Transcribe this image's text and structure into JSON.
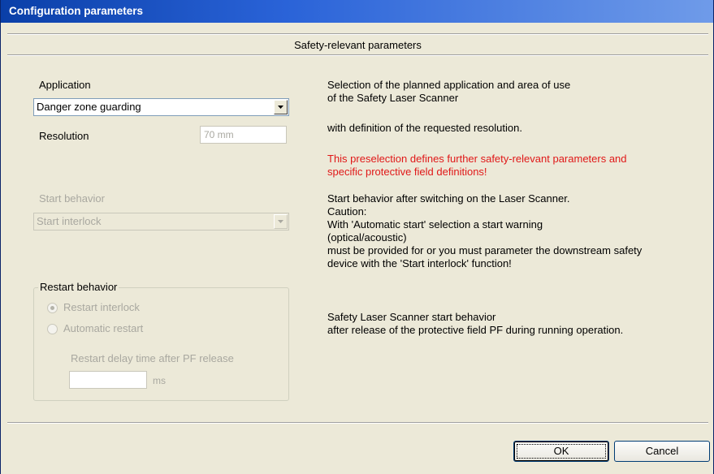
{
  "window": {
    "title": "Configuration parameters"
  },
  "section": {
    "title": "Safety-relevant parameters"
  },
  "application": {
    "label": "Application",
    "selected": "Danger zone guarding"
  },
  "resolution": {
    "label": "Resolution",
    "value": "70 mm"
  },
  "start_behavior": {
    "label": "Start behavior",
    "selected": "Start interlock"
  },
  "restart_behavior": {
    "group_title": "Restart behavior",
    "option_interlock": "Restart interlock",
    "option_automatic": "Automatic restart",
    "selected": "Restart interlock",
    "delay_label": "Restart delay time after PF release",
    "delay_value": "",
    "delay_unit": "ms"
  },
  "descriptions": {
    "application_line1": "Selection of the planned application and area of use",
    "application_line2": "of the Safety Laser Scanner",
    "resolution_line": "with definition of the requested resolution.",
    "warning_line1": "This preselection defines further safety-relevant parameters and",
    "warning_line2": "specific protective field definitions!",
    "start_line1": "Start behavior after switching on the Laser Scanner.",
    "start_line2": "Caution:",
    "start_line3": "With 'Automatic start' selection a start warning",
    "start_line4": "(optical/acoustic)",
    "start_line5": "must be provided for or you must parameter the downstream safety",
    "start_line6": "device with the 'Start interlock' function!",
    "restart_line1": "Safety Laser Scanner start behavior",
    "restart_line2": "after release of the protective field PF during running operation."
  },
  "buttons": {
    "ok": "OK",
    "cancel": "Cancel"
  },
  "colors": {
    "titlebar": "#2a63d8",
    "warning_text": "#e01818",
    "disabled_text": "#a9a8a0",
    "dialog_bg": "#ece9d8"
  }
}
